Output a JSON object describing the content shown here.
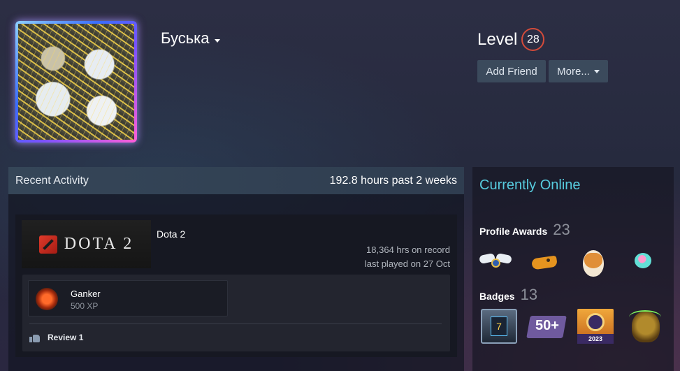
{
  "profile": {
    "name": "Буська",
    "level_label": "Level",
    "level_value": "28"
  },
  "actions": {
    "add_friend": "Add Friend",
    "more": "More..."
  },
  "recent_activity": {
    "title": "Recent Activity",
    "hours": "192.8 hours past 2 weeks",
    "game": {
      "capsule_text": "DOTA 2",
      "name": "Dota 2",
      "hours_on_record": "18,364 hrs on record",
      "last_played": "last played on 27 Oct",
      "achievement": {
        "name": "Ganker",
        "xp": "500 XP"
      },
      "review_label": "Review 1"
    }
  },
  "sidebar": {
    "status": "Currently Online",
    "awards_label": "Profile Awards",
    "awards_count": "23",
    "badges_label": "Badges",
    "badges_count": "13",
    "badges": {
      "b1": "7",
      "b2": "50+",
      "b3": "2023"
    }
  },
  "colors": {
    "online": "#57cbde",
    "level_ring": "#d44b3a",
    "button_bg": "#3b4a5c"
  }
}
